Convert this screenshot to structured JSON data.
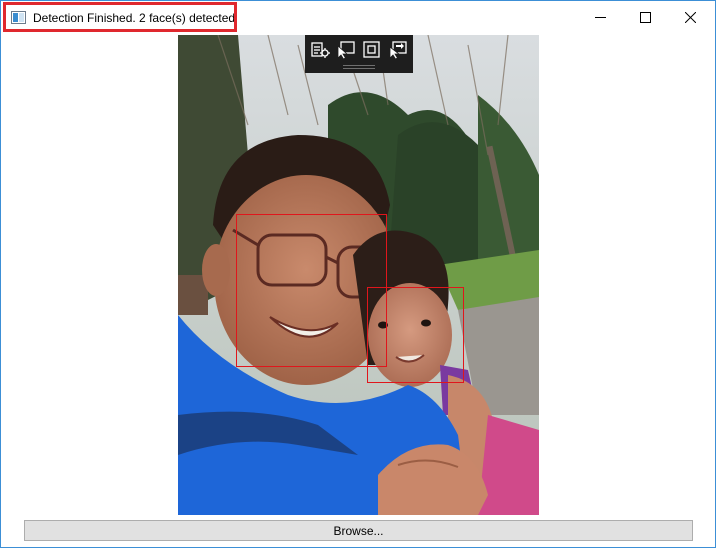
{
  "window": {
    "title": "Detection Finished. 2 face(s) detected",
    "icon": "app-window-icon",
    "controls": [
      "minimize-icon",
      "maximize-icon",
      "close-icon"
    ]
  },
  "colors": {
    "highlight": "#e0282e",
    "face_box": "#e0161c",
    "window_border": "#3c8fd6",
    "toolbar_bg": "#1e1e1e",
    "button_bg": "#e1e1e1"
  },
  "image": {
    "description_icons": [
      "photo-image"
    ],
    "detected_faces": 2
  },
  "debug_toolbar": {
    "icons": [
      "live-visual-tree-icon",
      "select-element-icon",
      "display-layout-adorners-icon",
      "track-focused-element-icon"
    ]
  },
  "browse": {
    "label": "Browse..."
  }
}
